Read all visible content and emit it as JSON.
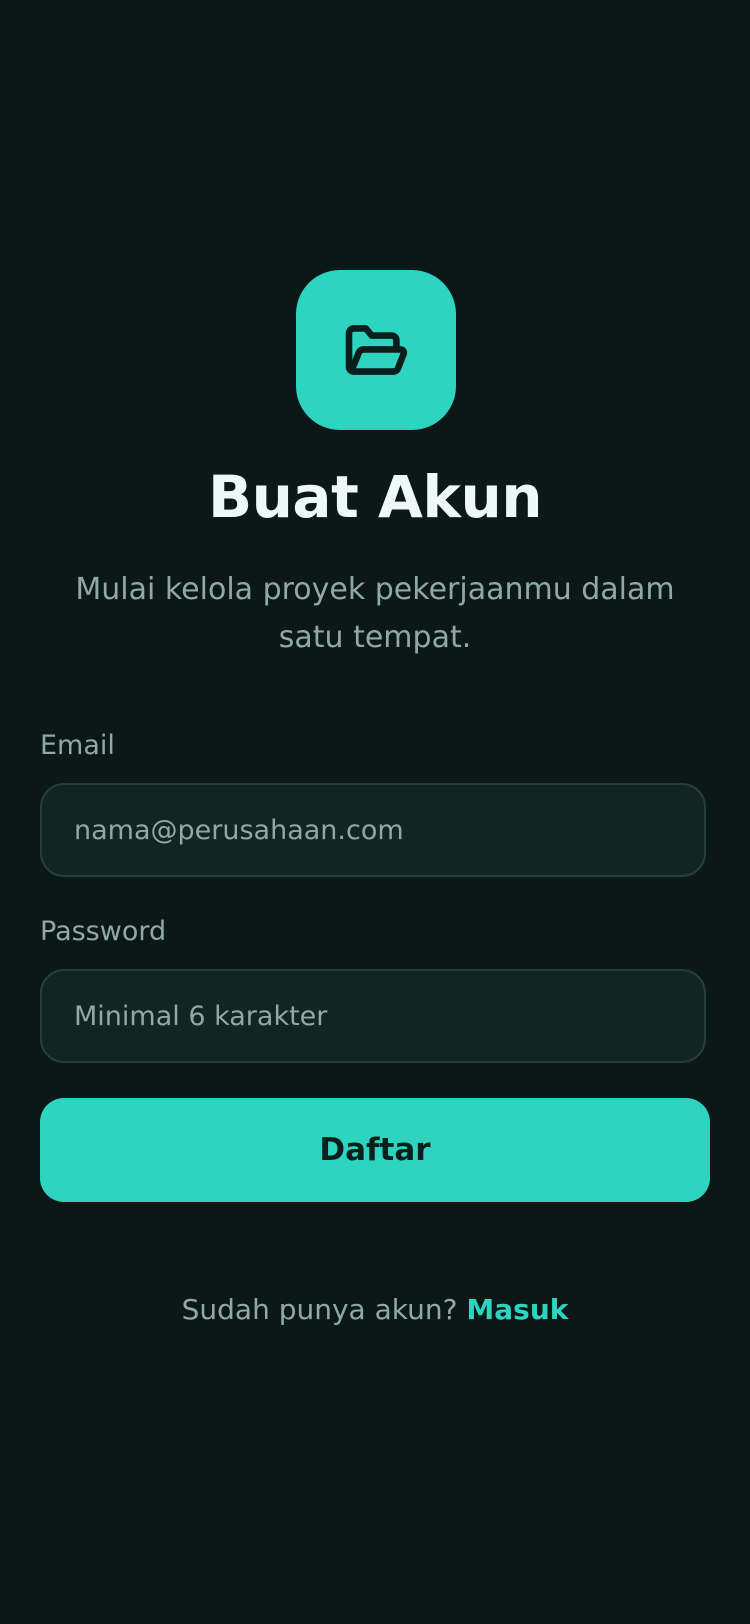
{
  "colors": {
    "background": "#0b1816",
    "accent": "#2dd4bf",
    "input_background": "#122523",
    "input_border": "#24403b",
    "muted_text": "#8fa9a3",
    "title_text": "#eef8f6"
  },
  "logo": {
    "icon": "folder-open-icon"
  },
  "header": {
    "title": "Buat Akun",
    "subtitle": "Mulai kelola proyek pekerjaanmu dalam satu tempat."
  },
  "form": {
    "email": {
      "label": "Email",
      "value": "",
      "placeholder": "nama@perusahaan.com"
    },
    "password": {
      "label": "Password",
      "value": "",
      "placeholder": "Minimal 6 karakter"
    },
    "submit_label": "Daftar"
  },
  "footer": {
    "prompt": "Sudah punya akun?",
    "link_label": "Masuk"
  }
}
